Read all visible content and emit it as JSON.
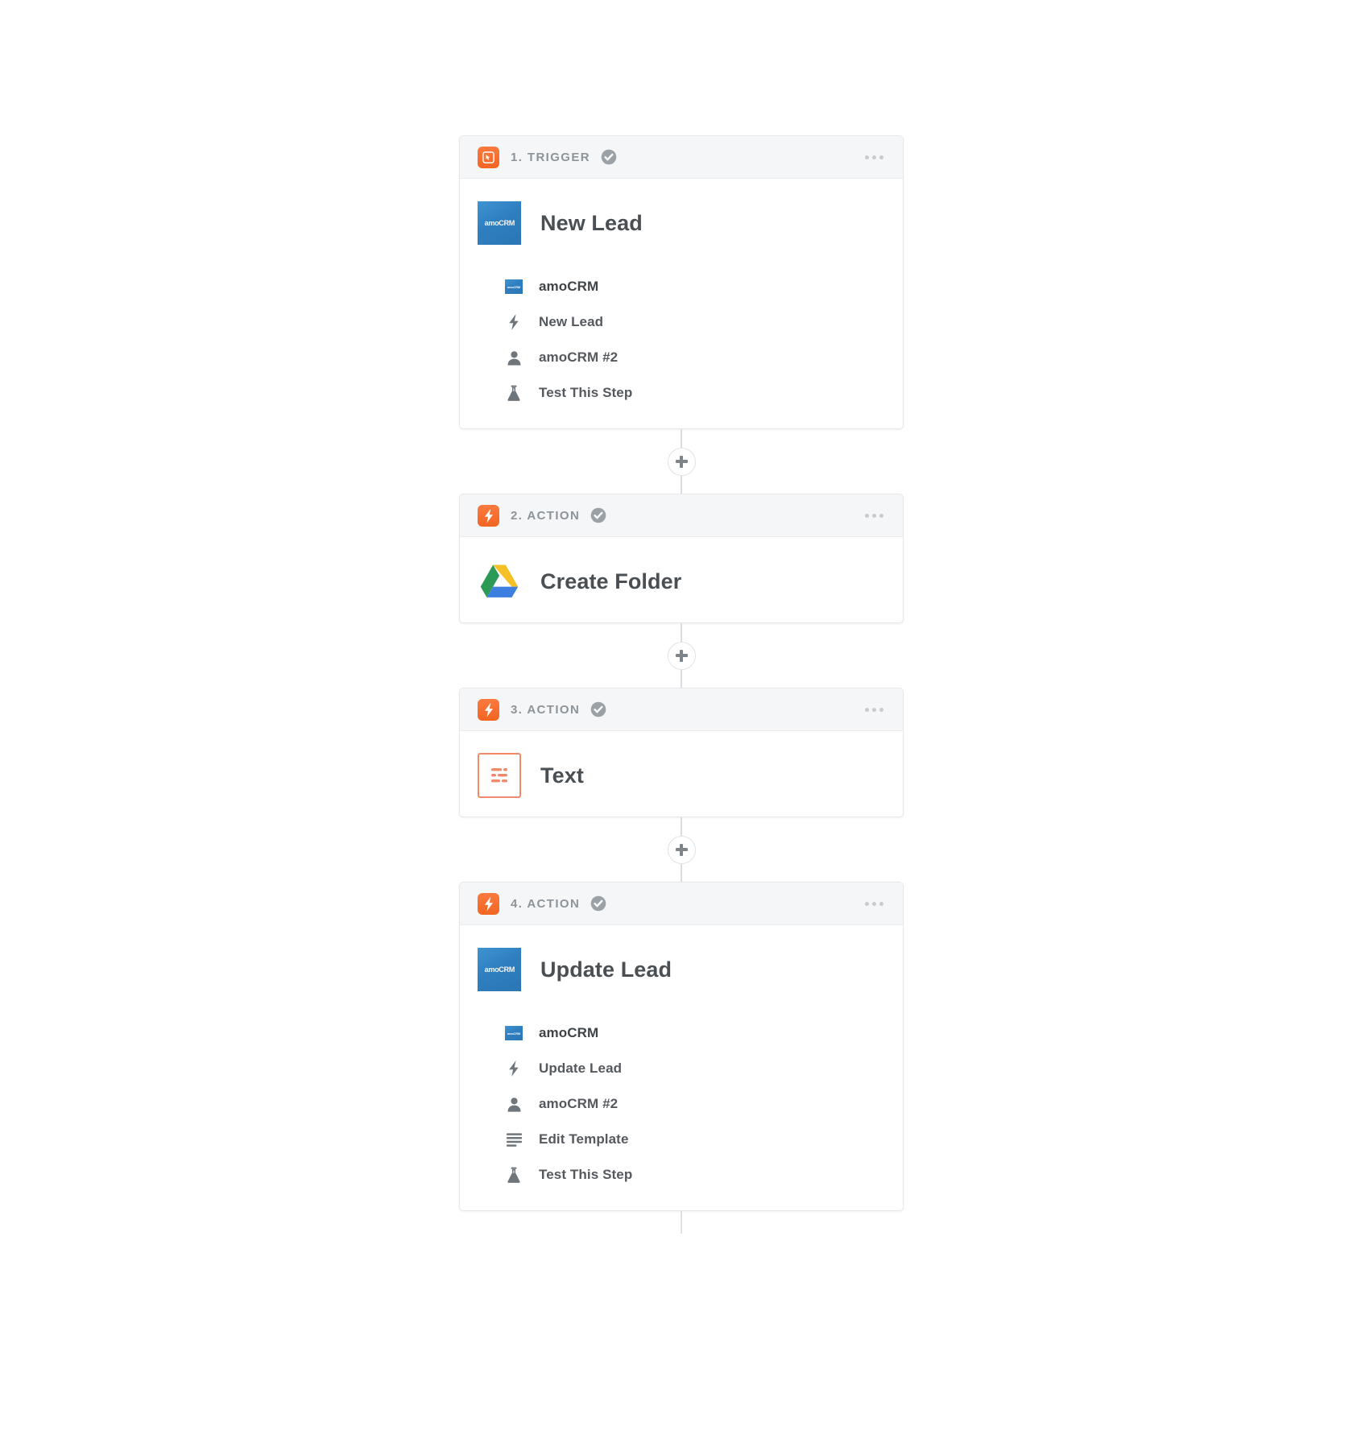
{
  "canvas": {
    "background": "#ffffff",
    "accent_orange": "#f26522",
    "accent_text_tool": "#f08a6b",
    "line_color": "#d9dde0"
  },
  "connector": {
    "add_step_label": "+",
    "add_step_name": "add-step-button"
  },
  "steps": [
    {
      "id": "step-1",
      "badge_icon": "trigger-cursor-icon",
      "label": "1. TRIGGER",
      "status_icon": "check-circle-icon",
      "menu_icon": "ellipsis-menu-icon",
      "app_icon": "amocrm-logo-icon",
      "app_icon_text": "amoCRM",
      "title": "New Lead",
      "details": [
        {
          "icon": "amocrm-logo-icon",
          "icon_text": "amoCRM",
          "label": "amoCRM",
          "emphasis": "strong"
        },
        {
          "icon": "lightning-bolt-icon",
          "label": "New Lead",
          "emphasis": "normal"
        },
        {
          "icon": "person-icon",
          "label": "amoCRM #2",
          "emphasis": "normal"
        },
        {
          "icon": "flask-icon",
          "label": "Test This Step",
          "emphasis": "normal"
        }
      ]
    },
    {
      "id": "step-2",
      "badge_icon": "lightning-bolt-icon",
      "label": "2. ACTION",
      "status_icon": "check-circle-icon",
      "menu_icon": "ellipsis-menu-icon",
      "app_icon": "google-drive-icon",
      "title": "Create Folder",
      "details": []
    },
    {
      "id": "step-3",
      "badge_icon": "lightning-bolt-icon",
      "label": "3. ACTION",
      "status_icon": "check-circle-icon",
      "menu_icon": "ellipsis-menu-icon",
      "app_icon": "text-formatter-icon",
      "title": "Text",
      "details": []
    },
    {
      "id": "step-4",
      "badge_icon": "lightning-bolt-icon",
      "label": "4. ACTION",
      "status_icon": "check-circle-icon",
      "menu_icon": "ellipsis-menu-icon",
      "app_icon": "amocrm-logo-icon",
      "app_icon_text": "amoCRM",
      "title": "Update Lead",
      "details": [
        {
          "icon": "amocrm-logo-icon",
          "icon_text": "amoCRM",
          "label": "amoCRM",
          "emphasis": "strong"
        },
        {
          "icon": "lightning-bolt-icon",
          "label": "Update Lead",
          "emphasis": "normal"
        },
        {
          "icon": "person-icon",
          "label": "amoCRM #2",
          "emphasis": "normal"
        },
        {
          "icon": "lines-icon",
          "label": "Edit Template",
          "emphasis": "normal"
        },
        {
          "icon": "flask-icon",
          "label": "Test This Step",
          "emphasis": "normal"
        }
      ]
    }
  ]
}
